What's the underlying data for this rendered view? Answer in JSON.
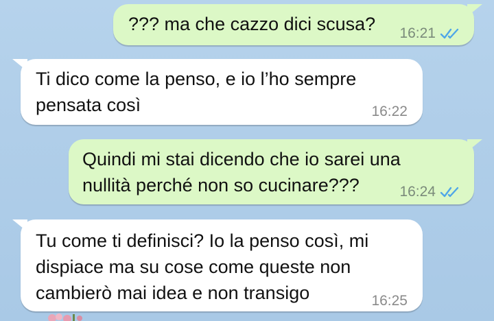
{
  "messages": [
    {
      "direction": "outgoing",
      "text": "??? ma che cazzo dici scusa?",
      "time": "16:21",
      "status_icon": "double-check-read-icon"
    },
    {
      "direction": "incoming",
      "text": "Ti dico come la penso, e io l’ho sempre\npensata così",
      "time": "16:22"
    },
    {
      "direction": "outgoing",
      "text": "Quindi mi stai dicendo che io sarei una\nnullità perché non so cucinare???",
      "time": "16:24",
      "status_icon": "double-check-read-icon"
    },
    {
      "direction": "incoming",
      "text": "Tu come ti definisci? Io la penso così, mi\ndispiace ma su cose come queste non\ncambierò mai idea e non transigo",
      "time": "16:25"
    }
  ],
  "colors": {
    "background": "#b0cee9",
    "outgoing_bubble": "#dcf8c6",
    "incoming_bubble": "#ffffff",
    "read_ticks": "#4fa6e8"
  }
}
